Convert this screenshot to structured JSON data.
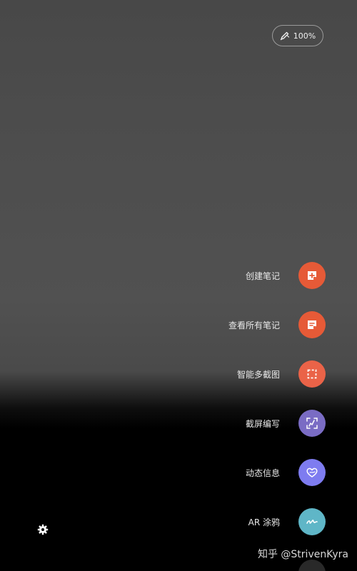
{
  "status": {
    "pen_battery": "100%",
    "pen_icon": "stylus-pen-icon"
  },
  "air_command": {
    "items": [
      {
        "label": "创建笔记",
        "icon": "create-note-icon",
        "color": "#e65a37"
      },
      {
        "label": "查看所有笔记",
        "icon": "view-notes-icon",
        "color": "#e65a37"
      },
      {
        "label": "智能多截图",
        "icon": "smart-select-icon",
        "color": "#ea6348"
      },
      {
        "label": "截屏编写",
        "icon": "screen-write-icon",
        "color": "#7a6cc4"
      },
      {
        "label": "动态信息",
        "icon": "live-message-icon",
        "color": "#7e7cf0"
      },
      {
        "label": "AR 涂鸦",
        "icon": "ar-doodle-icon",
        "color": "#5fb6c7"
      }
    ]
  },
  "settings": {
    "icon": "gear-icon"
  },
  "watermark": {
    "text": "知乎 @StrivenKyra"
  }
}
